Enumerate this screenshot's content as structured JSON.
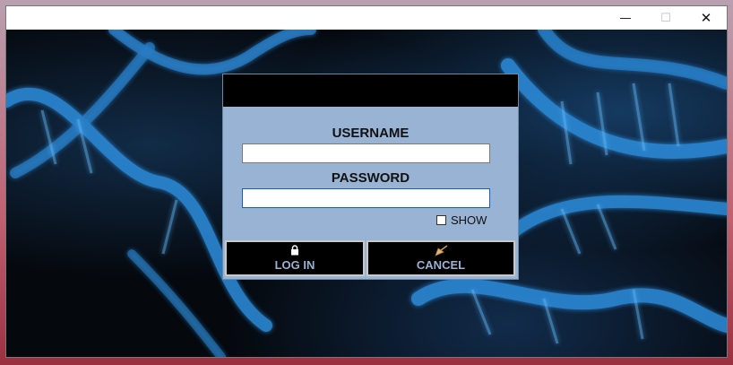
{
  "window": {
    "controls": {
      "minimize": "—",
      "maximize": "☐",
      "close": "✕"
    }
  },
  "login": {
    "username_label": "USERNAME",
    "username_value": "",
    "password_label": "PASSWORD",
    "password_value": "",
    "show_label": "SHOW",
    "login_button": "LOG IN",
    "cancel_button": "CANCEL"
  },
  "icons": {
    "login": "lock-icon",
    "cancel": "broom-icon"
  },
  "colors": {
    "panel": "#98b3d3",
    "header": "#000000",
    "button_text": "#98b3d3",
    "dna": "#2e8fe0"
  }
}
